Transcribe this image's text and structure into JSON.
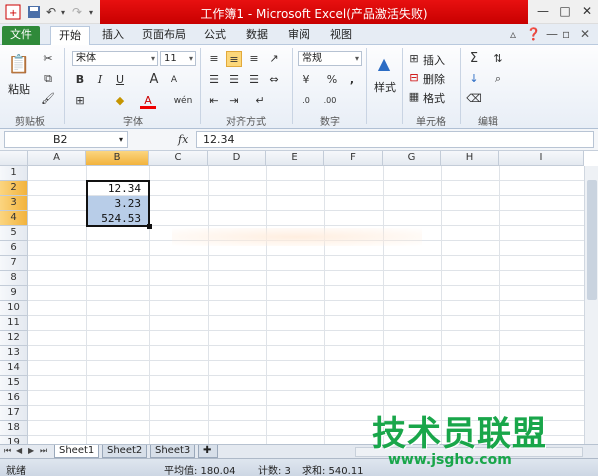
{
  "title": "工作簿1 - Microsoft Excel(产品激活失败)",
  "tabs": [
    "文件",
    "开始",
    "插入",
    "页面布局",
    "公式",
    "数据",
    "审阅",
    "视图"
  ],
  "ribbon": {
    "clipboard": {
      "paste": "粘贴",
      "label": "剪贴板"
    },
    "font": {
      "name": "宋体",
      "size": "11",
      "label": "字体",
      "bold": "B",
      "italic": "I",
      "underline": "U",
      "grow": "A",
      "shrink": "A",
      "font_color": "A",
      "phonetic": "wén"
    },
    "alignment": {
      "label": "对齐方式"
    },
    "number": {
      "format": "常规",
      "label": "数字",
      "percent": "%",
      "comma": ","
    },
    "styles": {
      "label": "样式"
    },
    "cells": {
      "insert": "插入",
      "delete": "删除",
      "format": "格式",
      "label": "单元格"
    },
    "editing": {
      "sum": "Σ",
      "label": "编辑"
    }
  },
  "formula_bar": {
    "name_box": "B2",
    "fx": "fx",
    "value": "12.34"
  },
  "columns": [
    "A",
    "B",
    "C",
    "D",
    "E",
    "F",
    "G",
    "H",
    "I"
  ],
  "rows": [
    "1",
    "2",
    "3",
    "4",
    "5",
    "6",
    "7",
    "8",
    "9",
    "10",
    "11",
    "12",
    "13",
    "14",
    "15",
    "16",
    "17",
    "18",
    "19"
  ],
  "cells": {
    "B2": "12.34",
    "B3": "3.23",
    "B4": "524.53"
  },
  "sheets": [
    "Sheet1",
    "Sheet2",
    "Sheet3"
  ],
  "status": {
    "ready": "就绪",
    "average": "平均值: 180.04",
    "count": "计数: 3",
    "sum": "求和: 540.11"
  },
  "watermark": {
    "text": "技术员联盟",
    "url": "www.jsgho.com"
  }
}
